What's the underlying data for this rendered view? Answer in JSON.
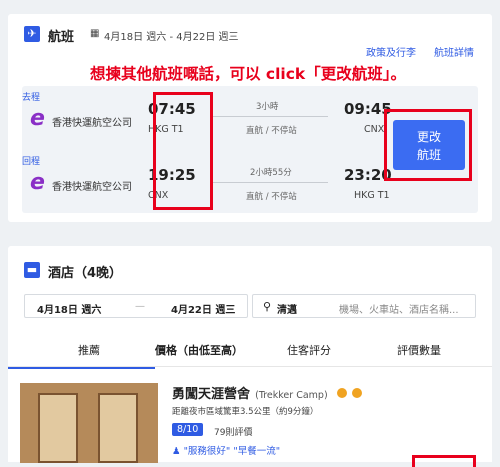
{
  "flight": {
    "title": "航班",
    "date_range": "4月18日 週六 - 4月22日 週三",
    "policy_link": "政策及行李",
    "details_link": "航班詳情",
    "annotation": "想揀其他航班嘅話，可以 click「更改航班」。",
    "change_button_line1": "更改",
    "change_button_line2": "航班",
    "legs": [
      {
        "label": "去程",
        "airline": "香港快運航空公司",
        "depart_time": "07:45",
        "depart_code": "HKG T1",
        "duration": "3小時",
        "stops": "直航 / 不停站",
        "arrive_time": "09:45",
        "arrive_code": "CNX"
      },
      {
        "label": "回程",
        "airline": "香港快運航空公司",
        "depart_time": "19:25",
        "depart_code": "CNX",
        "duration": "2小時55分",
        "stops": "直航 / 不停站",
        "arrive_time": "23:20",
        "arrive_code": "HKG T1"
      }
    ]
  },
  "hotel": {
    "title": "酒店（4晚）",
    "checkin": "4月18日 週六",
    "dash": "—",
    "checkout": "4月22日 週三",
    "location": "清邁",
    "search_placeholder": "機場、火車站、酒店名稱...",
    "tabs": [
      "推薦",
      "價格（由低至高）",
      "住客評分",
      "評價數量"
    ],
    "result": {
      "name": "勇闖天涯營舍",
      "name_en": "(Trekker Camp)",
      "distance": "距離夜市區域驚車3.5公里（約9分鐘）",
      "score": "8/10",
      "reviews": "79則評價",
      "highlights": "\"服務很好\" \"早餐一流\""
    }
  },
  "colors": {
    "accent": "#2f5be3",
    "annotation": "#e8001c",
    "airline_logo": "#8a2fc6"
  }
}
